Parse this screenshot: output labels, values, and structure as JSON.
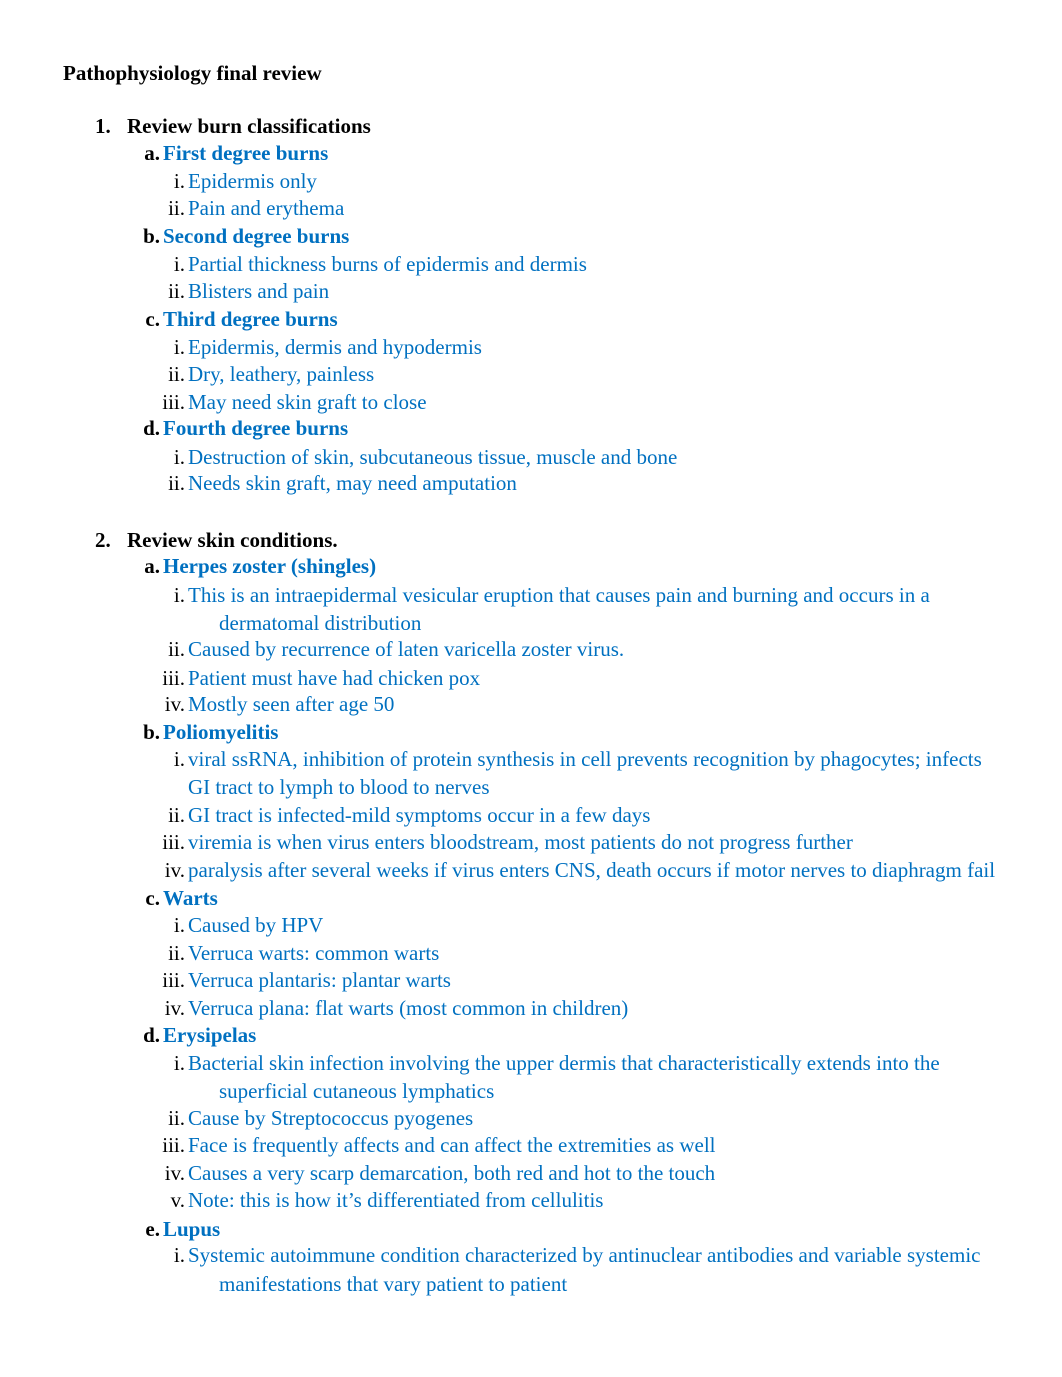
{
  "document": {
    "title": "Pathophysiology final review",
    "accent_color": "#0070C0",
    "sections": [
      {
        "number": "1.",
        "heading": "Review burn classifications",
        "items": [
          {
            "letter": "a.",
            "label": "First degree burns",
            "points": [
              {
                "numeral": "i.",
                "lines": [
                  "Epidermis only"
                ]
              },
              {
                "numeral": "ii.",
                "lines": [
                  "Pain and erythema"
                ]
              }
            ]
          },
          {
            "letter": "b.",
            "label": "Second degree burns",
            "points": [
              {
                "numeral": "i.",
                "lines": [
                  "Partial thickness burns of epidermis and dermis"
                ]
              },
              {
                "numeral": "ii.",
                "lines": [
                  "Blisters and pain"
                ]
              }
            ]
          },
          {
            "letter": "c.",
            "label": "Third degree burns",
            "points": [
              {
                "numeral": "i.",
                "lines": [
                  "Epidermis, dermis and hypodermis"
                ]
              },
              {
                "numeral": "ii.",
                "lines": [
                  "Dry, leathery, painless"
                ]
              },
              {
                "numeral": "iii.",
                "lines": [
                  "May need skin graft to close"
                ]
              }
            ]
          },
          {
            "letter": "d.",
            "label": "Fourth degree burns",
            "points": [
              {
                "numeral": "i.",
                "lines": [
                  "Destruction of skin, subcutaneous tissue, muscle and bone"
                ]
              },
              {
                "numeral": "ii.",
                "lines": [
                  "Needs skin graft, may need amputation"
                ]
              }
            ]
          }
        ]
      },
      {
        "number": "2.",
        "heading": "Review skin conditions.",
        "items": [
          {
            "letter": "a.",
            "label": "Herpes zoster (shingles)",
            "points": [
              {
                "numeral": "i.",
                "lines": [
                  "This is an intraepidermal vesicular eruption that causes pain and burning and occurs in a",
                  "dermatomal distribution"
                ]
              },
              {
                "numeral": "ii.",
                "lines": [
                  "Caused by recurrence of laten varicella zoster virus."
                ]
              },
              {
                "numeral": "iii.",
                "lines": [
                  "Patient must have had chicken pox"
                ]
              },
              {
                "numeral": "iv.",
                "lines": [
                  "Mostly seen after age 50"
                ]
              }
            ]
          },
          {
            "letter": "b.",
            "label": "Poliomyelitis",
            "points": [
              {
                "numeral": "i.",
                "lines": [
                  "viral ssRNA, inhibition of protein synthesis in cell prevents recognition by phagocytes; infects",
                  "GI tract to lymph to blood to nerves"
                ]
              },
              {
                "numeral": "ii.",
                "lines": [
                  "GI tract is infected-mild symptoms occur in a few days"
                ]
              },
              {
                "numeral": "iii.",
                "lines": [
                  "viremia is when virus enters bloodstream, most patients do not progress further"
                ]
              },
              {
                "numeral": "iv.",
                "lines": [
                  "paralysis after several weeks if virus enters CNS, death occurs if motor nerves to diaphragm fail"
                ]
              }
            ]
          },
          {
            "letter": "c.",
            "label": "Warts",
            "points": [
              {
                "numeral": "i.",
                "lines": [
                  "Caused by HPV"
                ]
              },
              {
                "numeral": "ii.",
                "lines": [
                  "Verruca warts: common warts"
                ]
              },
              {
                "numeral": "iii.",
                "lines": [
                  "Verruca plantaris: plantar warts"
                ]
              },
              {
                "numeral": "iv.",
                "lines": [
                  "Verruca plana: flat warts (most common in children)"
                ]
              }
            ]
          },
          {
            "letter": "d.",
            "label": "Erysipelas",
            "points": [
              {
                "numeral": "i.",
                "lines": [
                  "Bacterial skin infection involving the upper dermis that characteristically extends into the",
                  "superficial cutaneous lymphatics"
                ]
              },
              {
                "numeral": "ii.",
                "lines": [
                  "Cause by Streptococcus pyogenes"
                ]
              },
              {
                "numeral": "iii.",
                "lines": [
                  "Face is frequently affects and can affect the extremities as well"
                ]
              },
              {
                "numeral": "iv.",
                "lines": [
                  "Causes a very scarp demarcation, both red and hot to the touch"
                ]
              },
              {
                "numeral": "v.",
                "lines": [
                  "Note: this is how it’s differentiated from cellulitis"
                ]
              }
            ]
          },
          {
            "letter": "e.",
            "label": "Lupus",
            "points": [
              {
                "numeral": "i.",
                "lines": [
                  "Systemic autoimmune condition characterized by antinuclear antibodies and variable systemic",
                  "manifestations that vary patient to patient"
                ]
              }
            ]
          }
        ]
      }
    ]
  }
}
